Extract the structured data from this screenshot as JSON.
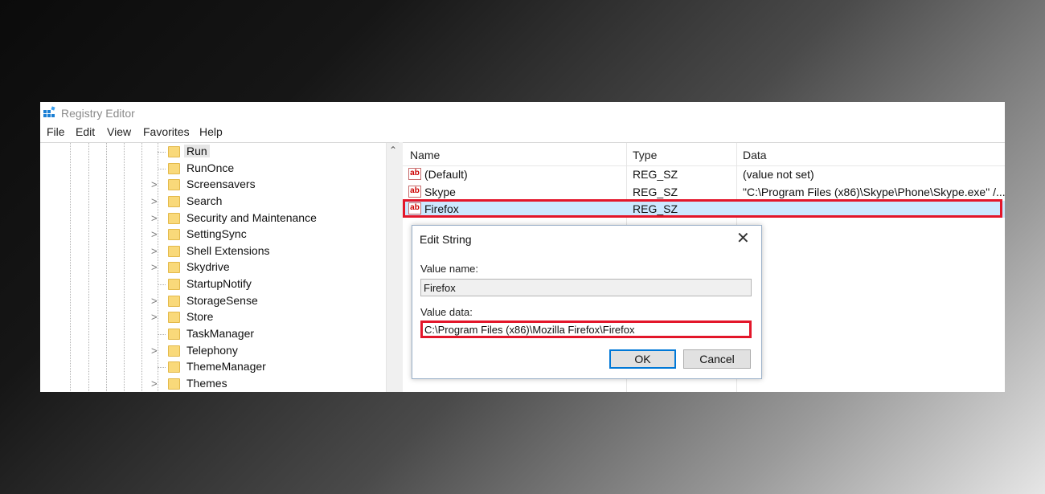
{
  "window": {
    "title": "Registry Editor"
  },
  "menu": [
    "File",
    "Edit",
    "View",
    "Favorites",
    "Help"
  ],
  "tree": [
    {
      "label": "Run",
      "expandable": false,
      "selected": true
    },
    {
      "label": "RunOnce",
      "expandable": false
    },
    {
      "label": "Screensavers",
      "expandable": true
    },
    {
      "label": "Search",
      "expandable": true
    },
    {
      "label": "Security and Maintenance",
      "expandable": true
    },
    {
      "label": "SettingSync",
      "expandable": true
    },
    {
      "label": "Shell Extensions",
      "expandable": true
    },
    {
      "label": "Skydrive",
      "expandable": true
    },
    {
      "label": "StartupNotify",
      "expandable": false
    },
    {
      "label": "StorageSense",
      "expandable": true
    },
    {
      "label": "Store",
      "expandable": true
    },
    {
      "label": "TaskManager",
      "expandable": false
    },
    {
      "label": "Telephony",
      "expandable": true
    },
    {
      "label": "ThemeManager",
      "expandable": false
    },
    {
      "label": "Themes",
      "expandable": true
    }
  ],
  "list": {
    "columns": {
      "name": "Name",
      "type": "Type",
      "data": "Data"
    },
    "rows": [
      {
        "name": "(Default)",
        "type": "REG_SZ",
        "data": "(value not set)"
      },
      {
        "name": "Skype",
        "type": "REG_SZ",
        "data": "\"C:\\Program Files (x86)\\Skype\\Phone\\Skype.exe\" /..."
      },
      {
        "name": "Firefox",
        "type": "REG_SZ",
        "data": ""
      }
    ],
    "icon_text": "ab"
  },
  "dialog": {
    "title": "Edit String",
    "value_name_label": "Value name:",
    "value_name": "Firefox",
    "value_data_label": "Value data:",
    "value_data": "C:\\Program Files (x86)\\Mozilla Firefox\\Firefox",
    "ok_label": "OK",
    "cancel_label": "Cancel",
    "close_glyph": "✕"
  },
  "colors": {
    "highlight": "#e3162a",
    "selection": "#cce8ff",
    "folder": "#f9d97a"
  }
}
